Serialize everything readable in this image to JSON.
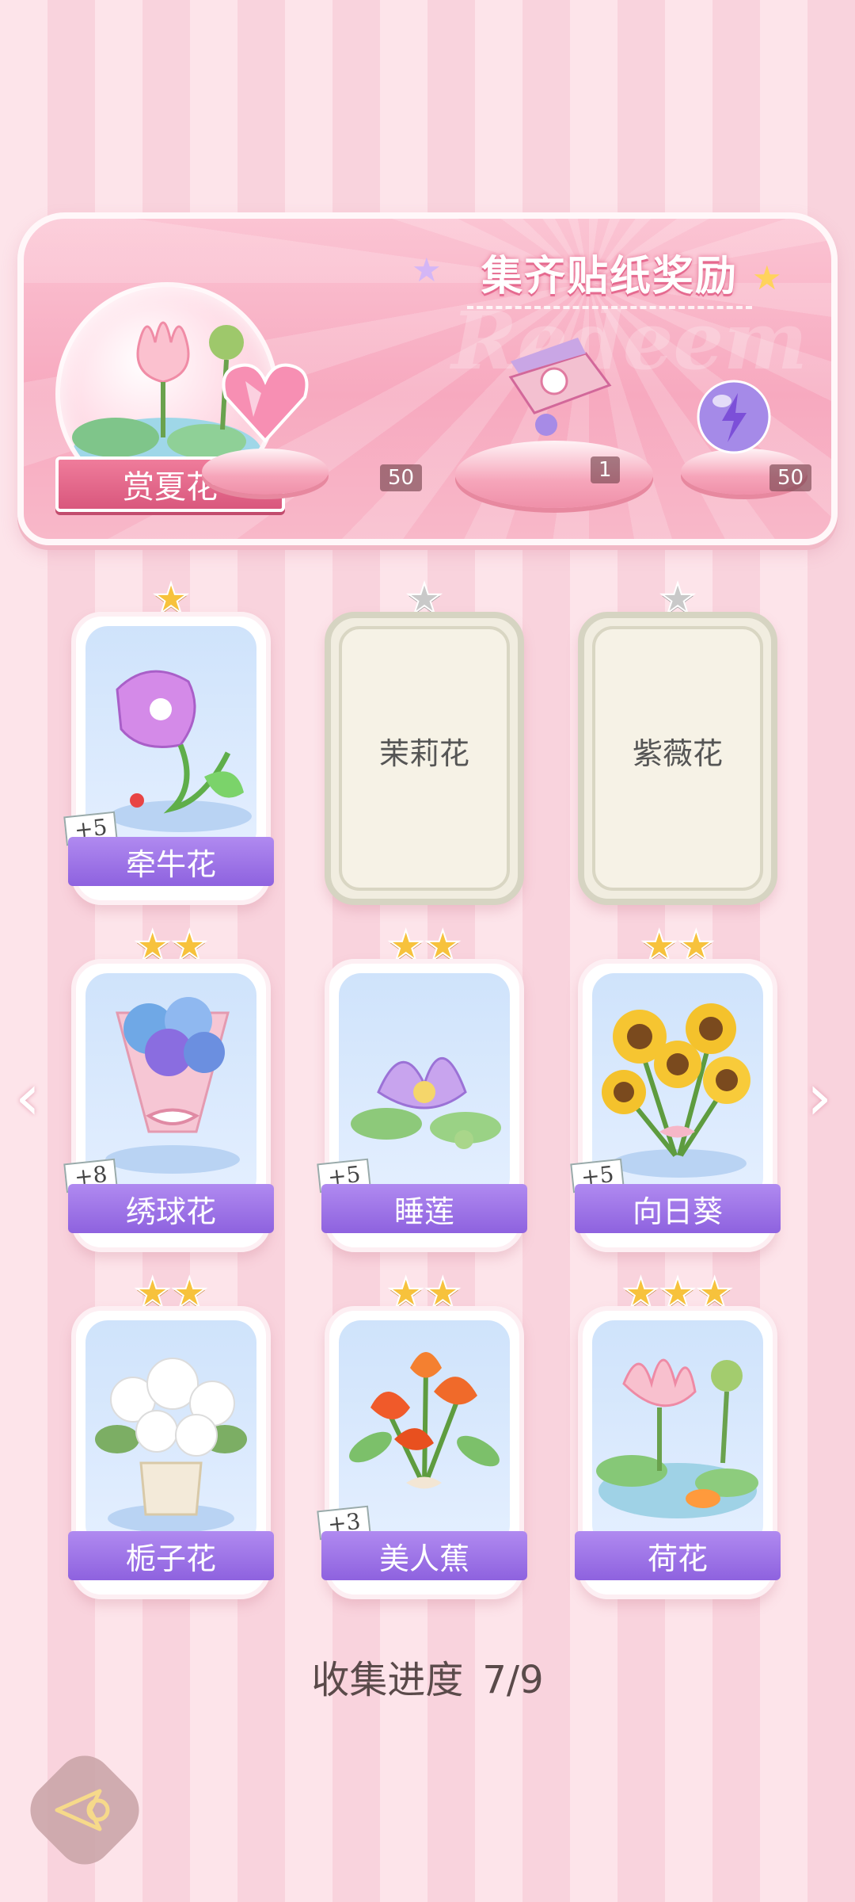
{
  "banner": {
    "title": "集齐贴纸奖励",
    "watermark": "Redeem",
    "album_label": "赏夏花",
    "rewards": [
      {
        "icon": "pink-heart-gem-icon",
        "count": "50"
      },
      {
        "icon": "gift-box-icon",
        "count": "1"
      },
      {
        "icon": "purple-energy-orb-icon",
        "count": "50"
      }
    ]
  },
  "cards": [
    {
      "name": "牵牛花",
      "stars": 1,
      "bonus": "+5",
      "collected": true
    },
    {
      "name": "茉莉花",
      "stars": 1,
      "bonus": "",
      "collected": false
    },
    {
      "name": "紫薇花",
      "stars": 1,
      "bonus": "",
      "collected": false
    },
    {
      "name": "绣球花",
      "stars": 2,
      "bonus": "+8",
      "collected": true
    },
    {
      "name": "睡莲",
      "stars": 2,
      "bonus": "+5",
      "collected": true
    },
    {
      "name": "向日葵",
      "stars": 2,
      "bonus": "+5",
      "collected": true
    },
    {
      "name": "栀子花",
      "stars": 2,
      "bonus": "",
      "collected": true
    },
    {
      "name": "美人蕉",
      "stars": 2,
      "bonus": "+3",
      "collected": true
    },
    {
      "name": "荷花",
      "stars": 3,
      "bonus": "",
      "collected": true
    }
  ],
  "progress": {
    "label": "收集进度",
    "value": "7/9"
  },
  "nav": {
    "prev_icon": "chevron-left-icon",
    "next_icon": "chevron-right-icon",
    "back_icon": "back-arrow-icon"
  },
  "star_glyph": "★",
  "arrow_left": "‹",
  "arrow_right": "›"
}
